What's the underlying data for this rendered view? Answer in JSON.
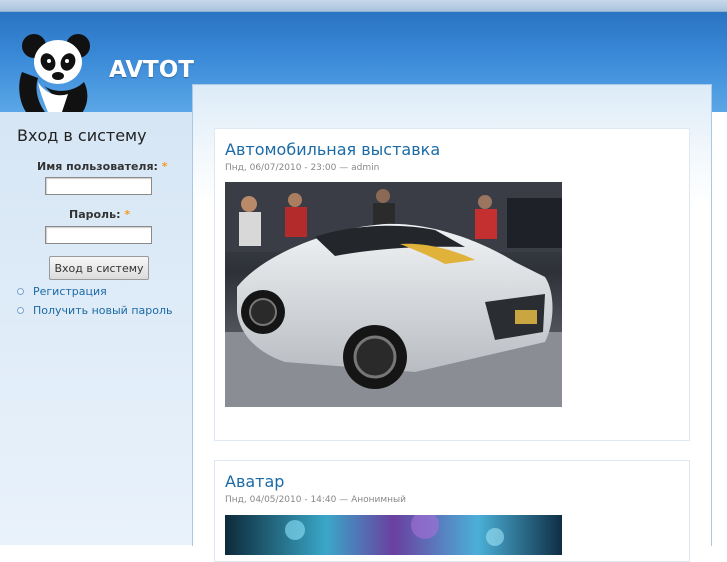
{
  "site": {
    "name": "AVTOT",
    "logo": "panda-logo"
  },
  "login": {
    "title": "Вход в систему",
    "username_label": "Имя пользователя:",
    "password_label": "Пароль:",
    "required_mark": "*",
    "username_value": "",
    "password_value": "",
    "submit_label": "Вход в систему",
    "links": [
      "Регистрация",
      "Получить новый пароль"
    ]
  },
  "posts": [
    {
      "title": "Автомобильная выставка",
      "meta": "Пнд, 06/07/2010 - 23:00 — admin",
      "image": "car-show-photo"
    },
    {
      "title": "Аватар",
      "meta": "Пнд, 04/05/2010 - 14:40 — Анонимный",
      "image": "avatar-movie-photo"
    }
  ],
  "colors": {
    "header_blue": "#2a73c2",
    "link": "#1b6aa5",
    "required": "#f39a24"
  }
}
